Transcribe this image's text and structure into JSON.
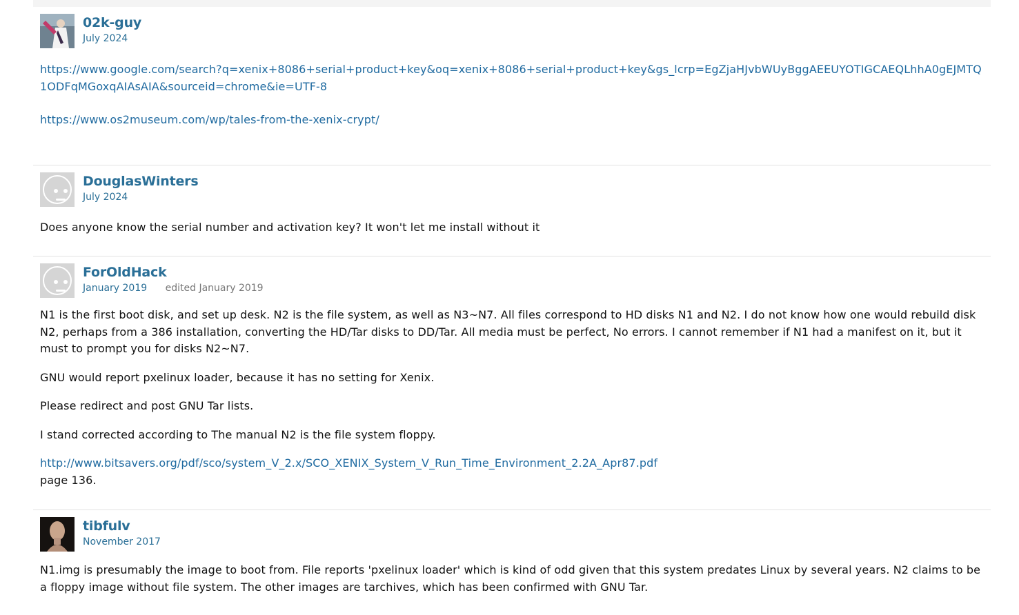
{
  "comments": [
    {
      "author": "02k-guy",
      "date": "July 2024",
      "paragraphs": [],
      "links": [
        "https://www.google.com/search?q=xenix+8086+serial+product+key&oq=xenix+8086+serial+product+key&gs_lcrp=EgZjaHJvbWUyBggAEEUYOTIGCAEQLhhA0gEJMTQ1ODFqMGoxqAIAsAIA&sourceid=chrome&ie=UTF-8",
        "https://www.os2museum.com/wp/tales-from-the-xenix-crypt/"
      ]
    },
    {
      "author": "DouglasWinters",
      "date": "July 2024",
      "paragraphs": [
        "Does anyone know the serial number and activation key? It won't let me install without it"
      ]
    },
    {
      "author": "ForOldHack",
      "date": "January 2019",
      "edited": "edited January 2019",
      "paragraphs": [
        "N1 is the first boot disk, and set up desk. N2 is the file system, as well as N3~N7. All files correspond to HD disks N1 and N2. I do not know how one would rebuild disk N2, perhaps from a 386 installation, converting the HD/Tar disks to DD/Tar. All media must be perfect, No errors. I cannot remember if N1 had a manifest on it, but it must to prompt you for disks N2~N7.",
        "GNU would report pxelinux loader, because it has no setting for Xenix.",
        "Please redirect and post GNU Tar lists.",
        "I stand corrected according to The manual N2 is the file system floppy."
      ],
      "link": "http://www.bitsavers.org/pdf/sco/system_V_2.x/SCO_XENIX_System_V_Run_Time_Environment_2.2A_Apr87.pdf",
      "after_link": "page 136."
    },
    {
      "author": "tibfulv",
      "date": "November 2017",
      "paragraphs": [
        "N1.img is presumably the image to boot from. File reports 'pxelinux loader' which is kind of odd given that this system predates Linux by several years. N2 claims to be a floppy image without file system. The other images are tarchives, which has been confirmed with GNU Tar."
      ]
    }
  ]
}
